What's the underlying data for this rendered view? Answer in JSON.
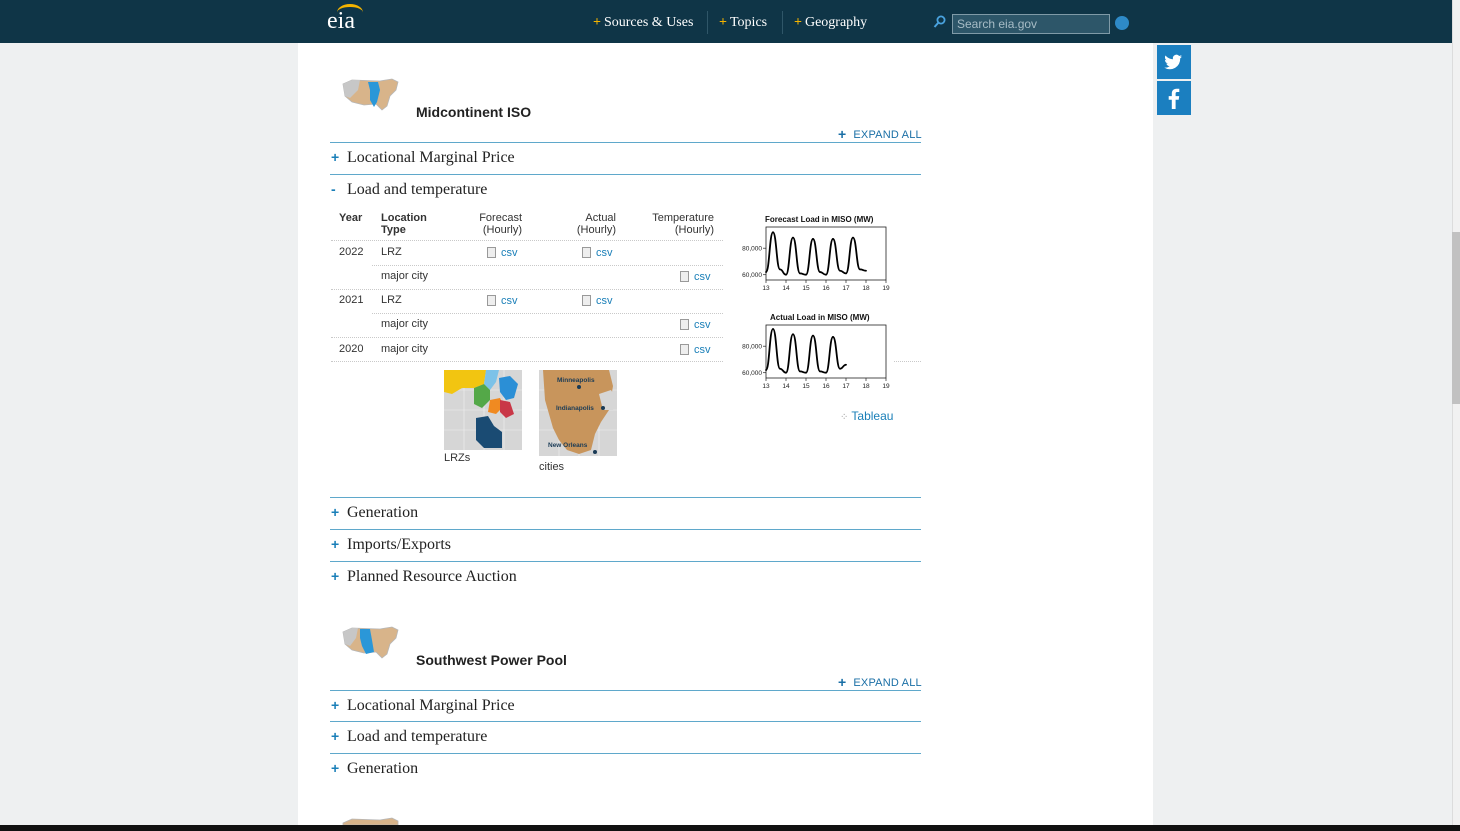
{
  "nav": {
    "logo": "eia",
    "items": [
      "Sources & Uses",
      "Topics",
      "Geography"
    ],
    "search_placeholder": "Search eia.gov"
  },
  "social": [
    "twitter-icon",
    "facebook-icon"
  ],
  "miso": {
    "title": "Midcontinent ISO",
    "expand_all": "EXPAND ALL",
    "sections": {
      "lmp": "Locational Marginal Price",
      "load": "Load and temperature",
      "generation": "Generation",
      "imports": "Imports/Exports",
      "auction": "Planned Resource Auction"
    },
    "table": {
      "headers": {
        "year": "Year",
        "loc1": "Location",
        "loc2": "Type",
        "fc1": "Forecast",
        "fc2": "(Hourly)",
        "ac1": "Actual",
        "ac2": "(Hourly)",
        "te1": "Temperature",
        "te2": "(Hourly)"
      },
      "rows": [
        {
          "year": "2022",
          "type": "LRZ",
          "forecast": "csv",
          "actual": "csv",
          "temperature": ""
        },
        {
          "year": "",
          "type": "major city",
          "forecast": "",
          "actual": "",
          "temperature": "csv"
        },
        {
          "year": "2021",
          "type": "LRZ",
          "forecast": "csv",
          "actual": "csv",
          "temperature": ""
        },
        {
          "year": "",
          "type": "major city",
          "forecast": "",
          "actual": "",
          "temperature": "csv"
        },
        {
          "year": "2020",
          "type": "major city",
          "forecast": "",
          "actual": "",
          "temperature": "csv"
        }
      ]
    },
    "maps": {
      "lrz_caption": "LRZs",
      "cities_caption": "cities",
      "city_labels": [
        "Minneapolis",
        "Indianapolis",
        "New Orleans"
      ]
    },
    "tableau": "Tableau"
  },
  "spp": {
    "title": "Southwest Power Pool",
    "expand_all": "EXPAND ALL",
    "sections": {
      "lmp": "Locational Marginal Price",
      "load": "Load and temperature",
      "generation": "Generation"
    }
  },
  "chart_data": [
    {
      "type": "line",
      "title": "Forecast Load in MISO (MW)",
      "xlabel": "",
      "ylabel": "",
      "x_ticks": [
        "13",
        "14",
        "15",
        "16",
        "17",
        "18",
        "19"
      ],
      "y_ticks": [
        "60,000",
        "80,000"
      ],
      "xlim": [
        13,
        19
      ],
      "ylim": [
        56000,
        96000
      ],
      "series": [
        {
          "x": [
            13.0,
            13.35,
            13.7,
            14.0,
            14.35,
            14.7,
            15.0,
            15.35,
            15.7,
            16.0,
            16.35,
            16.7,
            17.0,
            17.35,
            17.7,
            18.0
          ],
          "y": [
            62000,
            92000,
            64000,
            60000,
            88000,
            61000,
            60000,
            87000,
            62000,
            60000,
            87000,
            63000,
            61000,
            88000,
            64000,
            63000
          ]
        }
      ]
    },
    {
      "type": "line",
      "title": "Actual Load in MISO (MW)",
      "xlabel": "",
      "ylabel": "",
      "x_ticks": [
        "13",
        "14",
        "15",
        "16",
        "17",
        "18",
        "19"
      ],
      "y_ticks": [
        "60,000",
        "80,000"
      ],
      "xlim": [
        13,
        19
      ],
      "ylim": [
        56000,
        96000
      ],
      "series": [
        {
          "x": [
            13.0,
            13.35,
            13.7,
            14.0,
            14.35,
            14.7,
            15.0,
            15.35,
            15.7,
            16.0,
            16.35,
            16.7,
            17.0
          ],
          "y": [
            62000,
            93000,
            63000,
            60000,
            89000,
            61000,
            60000,
            88000,
            61000,
            60000,
            87000,
            63000,
            66000
          ]
        }
      ]
    }
  ]
}
